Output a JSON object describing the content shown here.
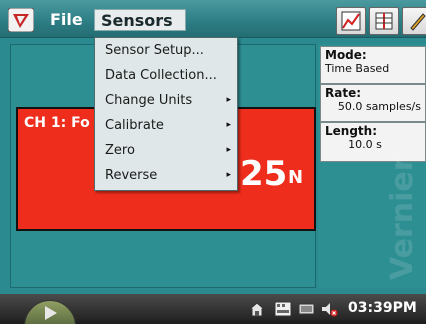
{
  "menubar": {
    "file_label": "File",
    "sensors_label": "Sensors"
  },
  "sensors_menu": {
    "items": [
      {
        "label": "Sensor Setup...",
        "submenu": false
      },
      {
        "label": "Data Collection...",
        "submenu": false
      },
      {
        "label": "Change Units",
        "submenu": true
      },
      {
        "label": "Calibrate",
        "submenu": true
      },
      {
        "label": "Zero",
        "submenu": true
      },
      {
        "label": "Reverse",
        "submenu": true
      }
    ],
    "submenu_arrow": "▸"
  },
  "meter": {
    "channel_label": "CH 1: Fo",
    "value": "25",
    "unit": "N",
    "color": "#ee2d1c"
  },
  "info": {
    "mode_label": "Mode:",
    "mode_value": "Time Based",
    "rate_label": "Rate:",
    "rate_value": "50.0 samples/s",
    "length_label": "Length:",
    "length_value": "10.0 s"
  },
  "watermark": "Vernier",
  "taskbar": {
    "time": "03:39PM"
  },
  "colors": {
    "background": "#2a8a8f",
    "menu_bg": "#dfe7e8",
    "meter_red": "#ee2d1c"
  }
}
